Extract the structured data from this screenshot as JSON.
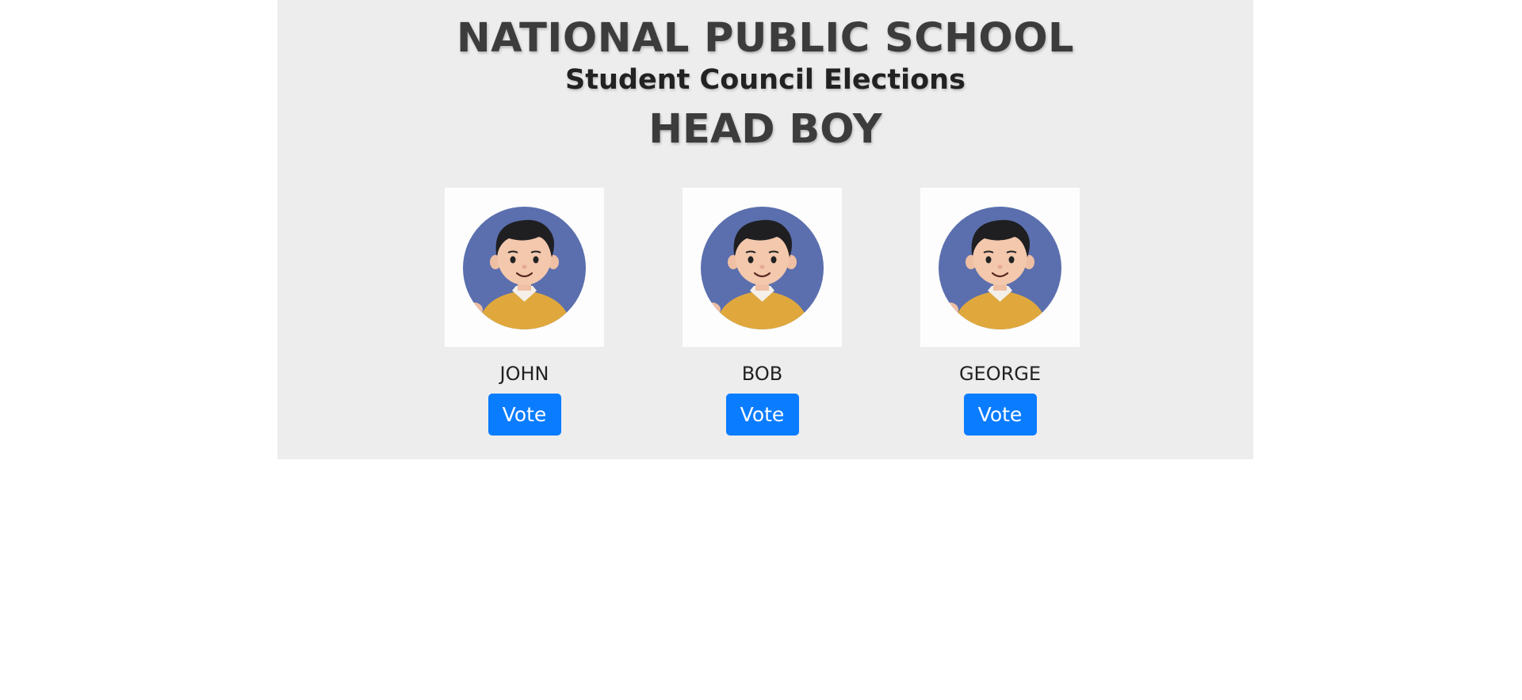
{
  "header": {
    "school_name": "NATIONAL PUBLIC SCHOOL",
    "subtitle": "Student Council Elections",
    "position": "HEAD BOY"
  },
  "candidates": [
    {
      "name": "JOHN",
      "vote_label": "Vote",
      "avatar_icon": "boy-avatar-icon"
    },
    {
      "name": "BOB",
      "vote_label": "Vote",
      "avatar_icon": "boy-avatar-icon"
    },
    {
      "name": "GEORGE",
      "vote_label": "Vote",
      "avatar_icon": "boy-avatar-icon"
    }
  ],
  "colors": {
    "panel_background": "#ededed",
    "vote_button": "#0a7cff",
    "avatar_background": "#5b6fae",
    "sweater": "#e0a83c"
  }
}
